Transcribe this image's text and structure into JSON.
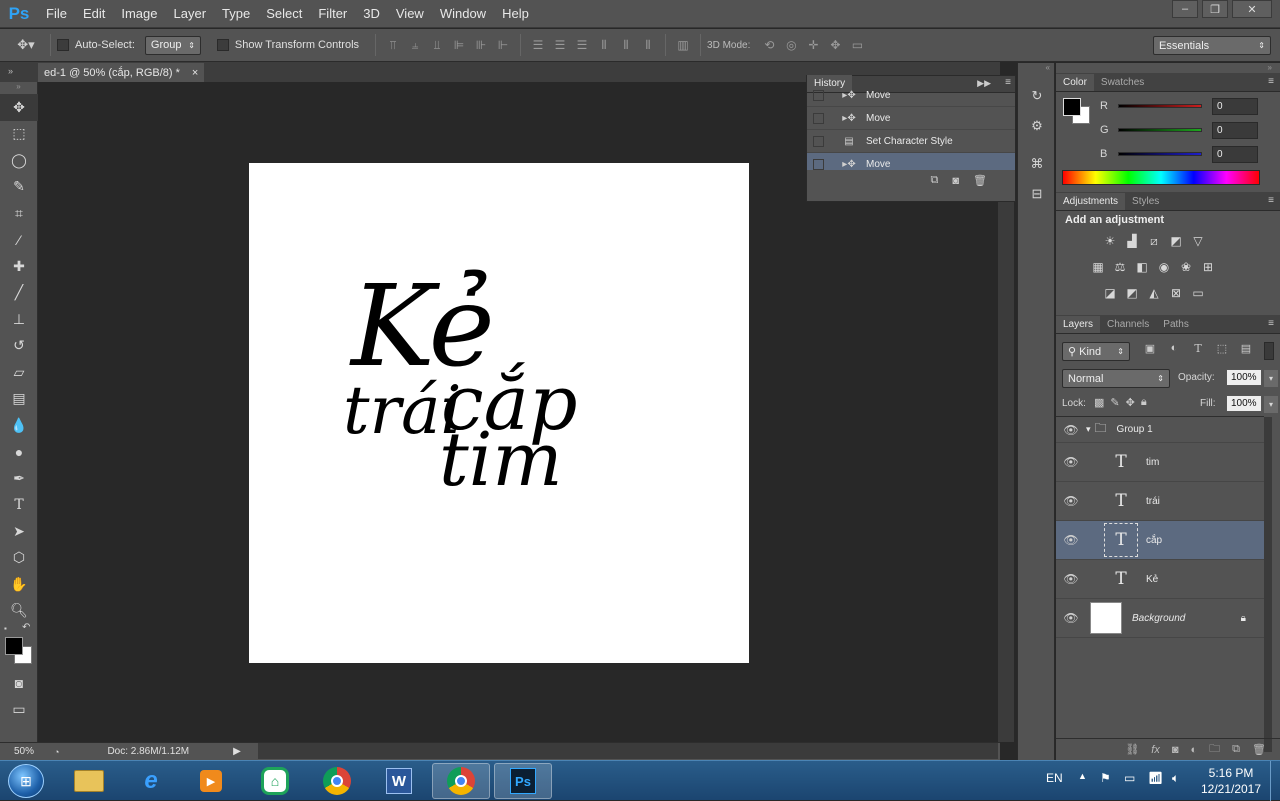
{
  "app": {
    "logo": "Ps",
    "menu": [
      "File",
      "Edit",
      "Image",
      "Layer",
      "Type",
      "Select",
      "Filter",
      "3D",
      "View",
      "Window",
      "Help"
    ],
    "window_controls": [
      "–",
      "❐",
      "✕"
    ]
  },
  "options_bar": {
    "auto_select_label": "Auto-Select:",
    "auto_select_value": "Group",
    "show_transform_label": "Show Transform Controls",
    "mode_3d_label": "3D Mode:",
    "workspace": "Essentials"
  },
  "document": {
    "tab_title": "ed-1 @ 50% (cắp, RGB/8) *",
    "close": "×",
    "zoom": "50%",
    "doc_info": "Doc: 2.86M/1.12M"
  },
  "canvas_text": {
    "ke": "Kẻ",
    "trai": "trái",
    "cap": "cắp",
    "tim": "tim"
  },
  "history": {
    "tab": "History",
    "items": [
      {
        "label": "Move",
        "icon": "move-icon",
        "selected": false
      },
      {
        "label": "Move",
        "icon": "move-icon",
        "selected": false
      },
      {
        "label": "Set Character Style",
        "icon": "doc-icon",
        "selected": false
      },
      {
        "label": "Move",
        "icon": "move-icon",
        "selected": true
      }
    ]
  },
  "color_panel": {
    "tabs": [
      "Color",
      "Swatches"
    ],
    "channels": [
      {
        "label": "R",
        "value": "0",
        "color": "#cc1e1e"
      },
      {
        "label": "G",
        "value": "0",
        "color": "#1ea81e"
      },
      {
        "label": "B",
        "value": "0",
        "color": "#1e1ecc"
      }
    ]
  },
  "adjustments_panel": {
    "tabs": [
      "Adjustments",
      "Styles"
    ],
    "heading": "Add an adjustment",
    "icons": [
      [
        "brightness-icon",
        "levels-icon",
        "curves-icon",
        "exposure-icon",
        "vibrance-icon"
      ],
      [
        "hue-saturation-icon",
        "color-balance-icon",
        "black-white-icon",
        "photo-filter-icon",
        "channel-mixer-icon",
        "color-lookup-icon"
      ],
      [
        "invert-icon",
        "posterize-icon",
        "threshold-icon",
        "selective-color-icon",
        "gradient-map-icon"
      ]
    ]
  },
  "layers_panel": {
    "tabs": [
      "Layers",
      "Channels",
      "Paths"
    ],
    "kind": "Kind",
    "blend_mode": "Normal",
    "opacity_label": "Opacity:",
    "opacity": "100%",
    "lock_label": "Lock:",
    "fill_label": "Fill:",
    "fill": "100%",
    "group_name": "Group 1",
    "layers": [
      {
        "name": "tim",
        "type": "text",
        "selected": false
      },
      {
        "name": "trái",
        "type": "text",
        "selected": false
      },
      {
        "name": "cắp",
        "type": "text",
        "selected": true
      },
      {
        "name": "Kẻ",
        "type": "text",
        "selected": false
      }
    ],
    "background": "Background"
  },
  "taskbar": {
    "lang": "EN",
    "time": "5:16 PM",
    "date": "12/21/2017"
  }
}
